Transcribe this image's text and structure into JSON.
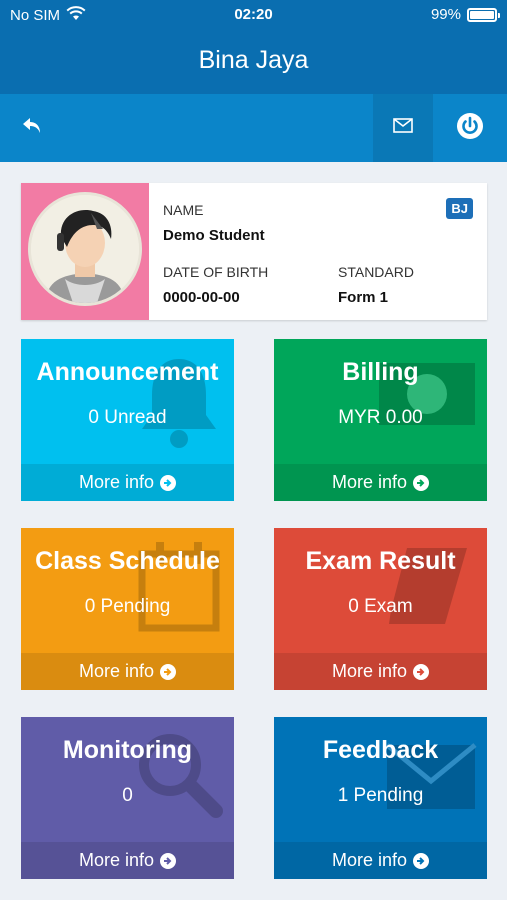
{
  "status_bar": {
    "carrier": "No SIM",
    "time": "02:20",
    "battery": "99%"
  },
  "app_title": "Bina Jaya",
  "profile": {
    "name_label": "NAME",
    "name": "Demo Student",
    "dob_label": "DATE OF BIRTH",
    "dob": "0000-00-00",
    "standard_label": "STANDARD",
    "standard": "Form 1",
    "badge": "BJ"
  },
  "tiles": [
    {
      "title": "Announcement",
      "sub": "0 Unread",
      "more": "More info",
      "color": "#00c0ef",
      "icon": "bell-icon"
    },
    {
      "title": "Billing",
      "sub": "MYR 0.00",
      "more": "More info",
      "color": "#00a65a",
      "icon": "money-icon"
    },
    {
      "title": "Class Schedule",
      "sub": "0 Pending",
      "more": "More info",
      "color": "#f39c12",
      "icon": "calendar-icon"
    },
    {
      "title": "Exam Result",
      "sub": "0 Exam",
      "more": "More info",
      "color": "#dd4b39",
      "icon": "book-icon"
    },
    {
      "title": "Monitoring",
      "sub": "0",
      "more": "More info",
      "color": "#605ca8",
      "icon": "search-icon"
    },
    {
      "title": "Feedback",
      "sub": "1 Pending",
      "more": "More info",
      "color": "#0073b7",
      "icon": "envelope-icon"
    }
  ],
  "colors": {
    "header": "#0a6eb0",
    "toolbar": "#0b85c9",
    "avatar_bg": "#f27ba4",
    "badge": "#1d6fb8",
    "page_bg": "#ecf0f5"
  }
}
